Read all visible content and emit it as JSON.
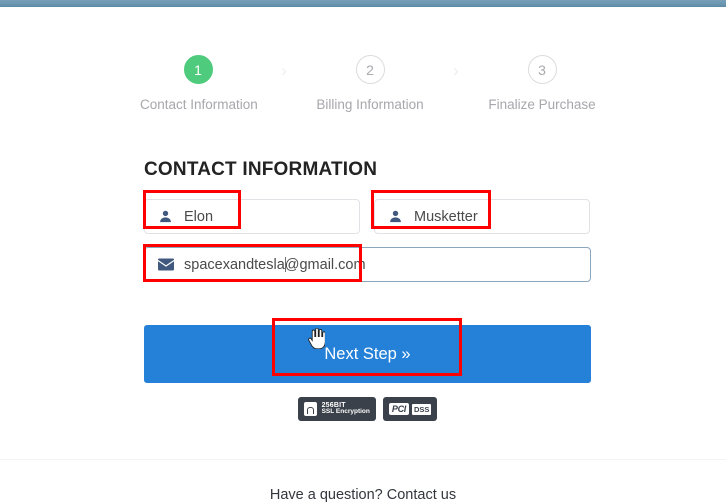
{
  "stepper": {
    "separator": "›",
    "steps": [
      {
        "number": "1",
        "label": "Contact Information",
        "state": "active"
      },
      {
        "number": "2",
        "label": "Billing Information",
        "state": "inactive"
      },
      {
        "number": "3",
        "label": "Finalize Purchase",
        "state": "inactive"
      }
    ]
  },
  "form": {
    "section_title": "CONTACT INFORMATION",
    "first_name": {
      "value": "Elon",
      "icon": "user-icon"
    },
    "last_name": {
      "value": "Musketter",
      "icon": "user-icon"
    },
    "email": {
      "value": "spacexandtesla@gmail.com",
      "value_before_caret": "spacexandtesla",
      "value_after_caret": "@gmail.com",
      "icon": "envelope-icon"
    },
    "submit_label": "Next Step »"
  },
  "badges": {
    "ssl": {
      "line1": "256BIT",
      "line2": "SSL Encryption",
      "icon": "lock-icon"
    },
    "pci": {
      "mark": "PCI",
      "suffix": "DSS"
    }
  },
  "footer": {
    "text": "Have a question? Contact us"
  },
  "colors": {
    "accent_blue": "#2581d8",
    "active_step_green": "#4fcb7d",
    "top_bar": "#6b97b0",
    "annotation_red": "#ff0000",
    "icon_navy": "#41597f",
    "badge_dark": "#3a414a"
  }
}
